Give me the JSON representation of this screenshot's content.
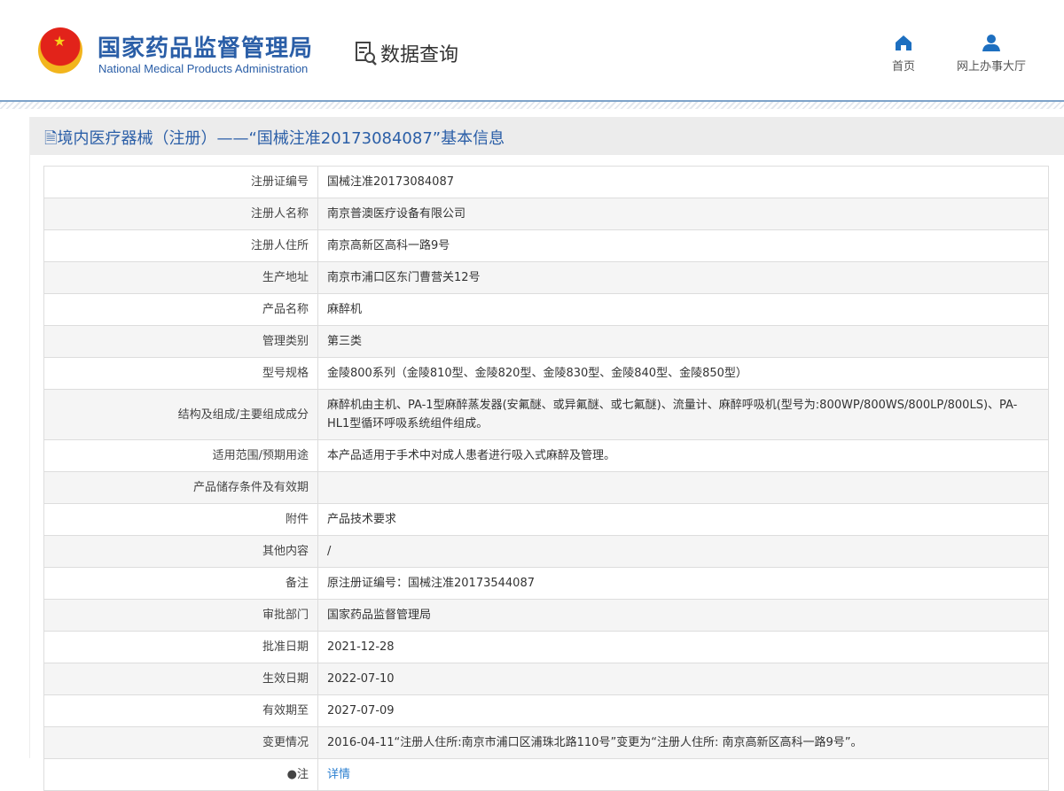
{
  "header": {
    "title_cn": "国家药品监督管理局",
    "title_en": "National Medical Products Administration",
    "data_query": "数据查询",
    "nav": [
      {
        "label": "首页",
        "icon": "home-icon"
      },
      {
        "label": "网上办事大厅",
        "icon": "user-icon"
      }
    ]
  },
  "page_title": "境内医疗器械（注册）——“国械注准20173084087”基本信息",
  "rows": [
    {
      "label": "注册证编号",
      "value": "国械注准20173084087"
    },
    {
      "label": "注册人名称",
      "value": "南京普澳医疗设备有限公司"
    },
    {
      "label": "注册人住所",
      "value": "南京高新区高科一路9号"
    },
    {
      "label": "生产地址",
      "value": "南京市浦口区东门曹营关12号"
    },
    {
      "label": "产品名称",
      "value": "麻醉机"
    },
    {
      "label": "管理类别",
      "value": "第三类"
    },
    {
      "label": "型号规格",
      "value": "金陵800系列（金陵810型、金陵820型、金陵830型、金陵840型、金陵850型）"
    },
    {
      "label": "结构及组成/主要组成成分",
      "value": "麻醉机由主机、PA-1型麻醉蒸发器(安氟醚、或异氟醚、或七氟醚)、流量计、麻醉呼吸机(型号为:800WP/800WS/800LP/800LS)、PA-HL1型循环呼吸系统组件组成。"
    },
    {
      "label": "适用范围/预期用途",
      "value": "本产品适用于手术中对成人患者进行吸入式麻醉及管理。"
    },
    {
      "label": "产品储存条件及有效期",
      "value": ""
    },
    {
      "label": "附件",
      "value": "产品技术要求"
    },
    {
      "label": "其他内容",
      "value": "/"
    },
    {
      "label": "备注",
      "value": "原注册证编号：国械注准20173544087"
    },
    {
      "label": "审批部门",
      "value": "国家药品监督管理局"
    },
    {
      "label": "批准日期",
      "value": "2021-12-28"
    },
    {
      "label": "生效日期",
      "value": "2022-07-10"
    },
    {
      "label": "有效期至",
      "value": "2027-07-09"
    },
    {
      "label": "变更情况",
      "value": "2016-04-11“注册人住所:南京市浦口区浦珠北路110号”变更为“注册人住所: 南京高新区高科一路9号”。"
    }
  ],
  "note": {
    "label": "注",
    "link": "详情"
  }
}
